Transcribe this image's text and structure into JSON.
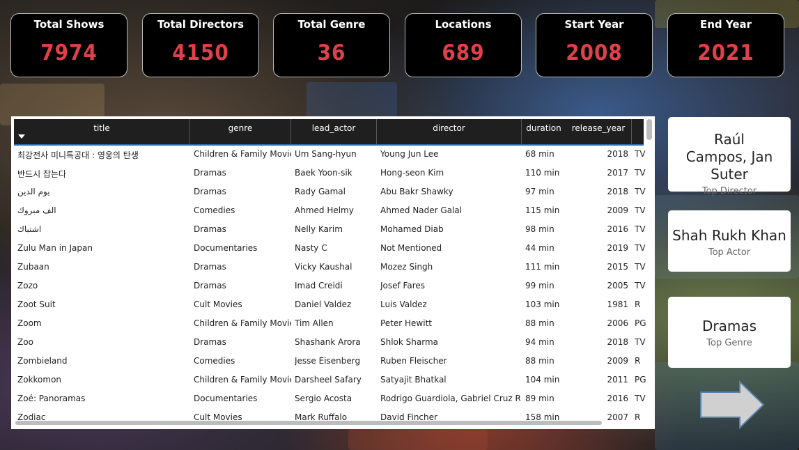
{
  "kpis": [
    {
      "label": "Total Shows",
      "value": "7974"
    },
    {
      "label": "Total Directors",
      "value": "4150"
    },
    {
      "label": "Total Genre",
      "value": "36"
    },
    {
      "label": "Locations",
      "value": "689"
    },
    {
      "label": "Start Year",
      "value": "2008"
    },
    {
      "label": "End Year",
      "value": "2021"
    }
  ],
  "table": {
    "columns": [
      "title",
      "genre",
      "lead_actor",
      "director",
      "duration",
      "release_year"
    ],
    "rows": [
      {
        "title": "최강전사 미니특공대 : 영웅의 탄생",
        "genre": "Children & Family Movies",
        "lead_actor": "Um Sang-hyun",
        "director": "Young Jun Lee",
        "duration": "68 min",
        "release_year": "2018",
        "rating": "TV"
      },
      {
        "title": "반드시 잡는다",
        "genre": "Dramas",
        "lead_actor": "Baek Yoon-sik",
        "director": "Hong-seon Kim",
        "duration": "110 min",
        "release_year": "2017",
        "rating": "TV"
      },
      {
        "title": "يوم الدين",
        "genre": "Dramas",
        "lead_actor": "Rady Gamal",
        "director": "Abu Bakr Shawky",
        "duration": "97 min",
        "release_year": "2018",
        "rating": "TV"
      },
      {
        "title": "الف مبروك",
        "genre": "Comedies",
        "lead_actor": "Ahmed Helmy",
        "director": "Ahmed Nader Galal",
        "duration": "115 min",
        "release_year": "2009",
        "rating": "TV"
      },
      {
        "title": "اشتباك",
        "genre": "Dramas",
        "lead_actor": "Nelly Karim",
        "director": "Mohamed Diab",
        "duration": "98 min",
        "release_year": "2016",
        "rating": "TV"
      },
      {
        "title": "Zulu Man in Japan",
        "genre": "Documentaries",
        "lead_actor": "Nasty C",
        "director": "Not Mentioned",
        "duration": "44 min",
        "release_year": "2019",
        "rating": "TV"
      },
      {
        "title": "Zubaan",
        "genre": "Dramas",
        "lead_actor": "Vicky Kaushal",
        "director": "Mozez Singh",
        "duration": "111 min",
        "release_year": "2015",
        "rating": "TV"
      },
      {
        "title": "Zozo",
        "genre": "Dramas",
        "lead_actor": "Imad Creidi",
        "director": "Josef Fares",
        "duration": "99 min",
        "release_year": "2005",
        "rating": "TV"
      },
      {
        "title": "Zoot Suit",
        "genre": "Cult Movies",
        "lead_actor": "Daniel Valdez",
        "director": "Luis Valdez",
        "duration": "103 min",
        "release_year": "1981",
        "rating": "R"
      },
      {
        "title": "Zoom",
        "genre": "Children & Family Movies",
        "lead_actor": "Tim Allen",
        "director": "Peter Hewitt",
        "duration": "88 min",
        "release_year": "2006",
        "rating": "PG"
      },
      {
        "title": "Zoo",
        "genre": "Dramas",
        "lead_actor": "Shashank Arora",
        "director": "Shlok Sharma",
        "duration": "94 min",
        "release_year": "2018",
        "rating": "TV"
      },
      {
        "title": "Zombieland",
        "genre": "Comedies",
        "lead_actor": "Jesse Eisenberg",
        "director": "Ruben Fleischer",
        "duration": "88 min",
        "release_year": "2009",
        "rating": "R"
      },
      {
        "title": "Zokkomon",
        "genre": "Children & Family Movies",
        "lead_actor": "Darsheel Safary",
        "director": "Satyajit Bhatkal",
        "duration": "104 min",
        "release_year": "2011",
        "rating": "PG"
      },
      {
        "title": "Zoé: Panoramas",
        "genre": "Documentaries",
        "lead_actor": "Sergio Acosta",
        "director": "Rodrigo Guardiola, Gabriel Cruz Rivas",
        "duration": "89 min",
        "release_year": "2016",
        "rating": "TV"
      },
      {
        "title": "Zodiac",
        "genre": "Cult Movies",
        "lead_actor": "Mark Ruffalo",
        "director": "David Fincher",
        "duration": "158 min",
        "release_year": "2007",
        "rating": "R"
      }
    ]
  },
  "cards": {
    "director": {
      "value": "Raúl Campos, Jan Suter",
      "label": "Top Director"
    },
    "actor": {
      "value": "Shah Rukh Khan",
      "label": "Top Actor"
    },
    "genre": {
      "value": "Dramas",
      "label": "Top Genre"
    }
  },
  "icons": {
    "sort": "sort-descending-icon",
    "next": "arrow-right-icon"
  },
  "colors": {
    "kpi_value": "#e0404a",
    "header_bg": "#1f1f1f",
    "header_underline": "#2b6cb0"
  }
}
